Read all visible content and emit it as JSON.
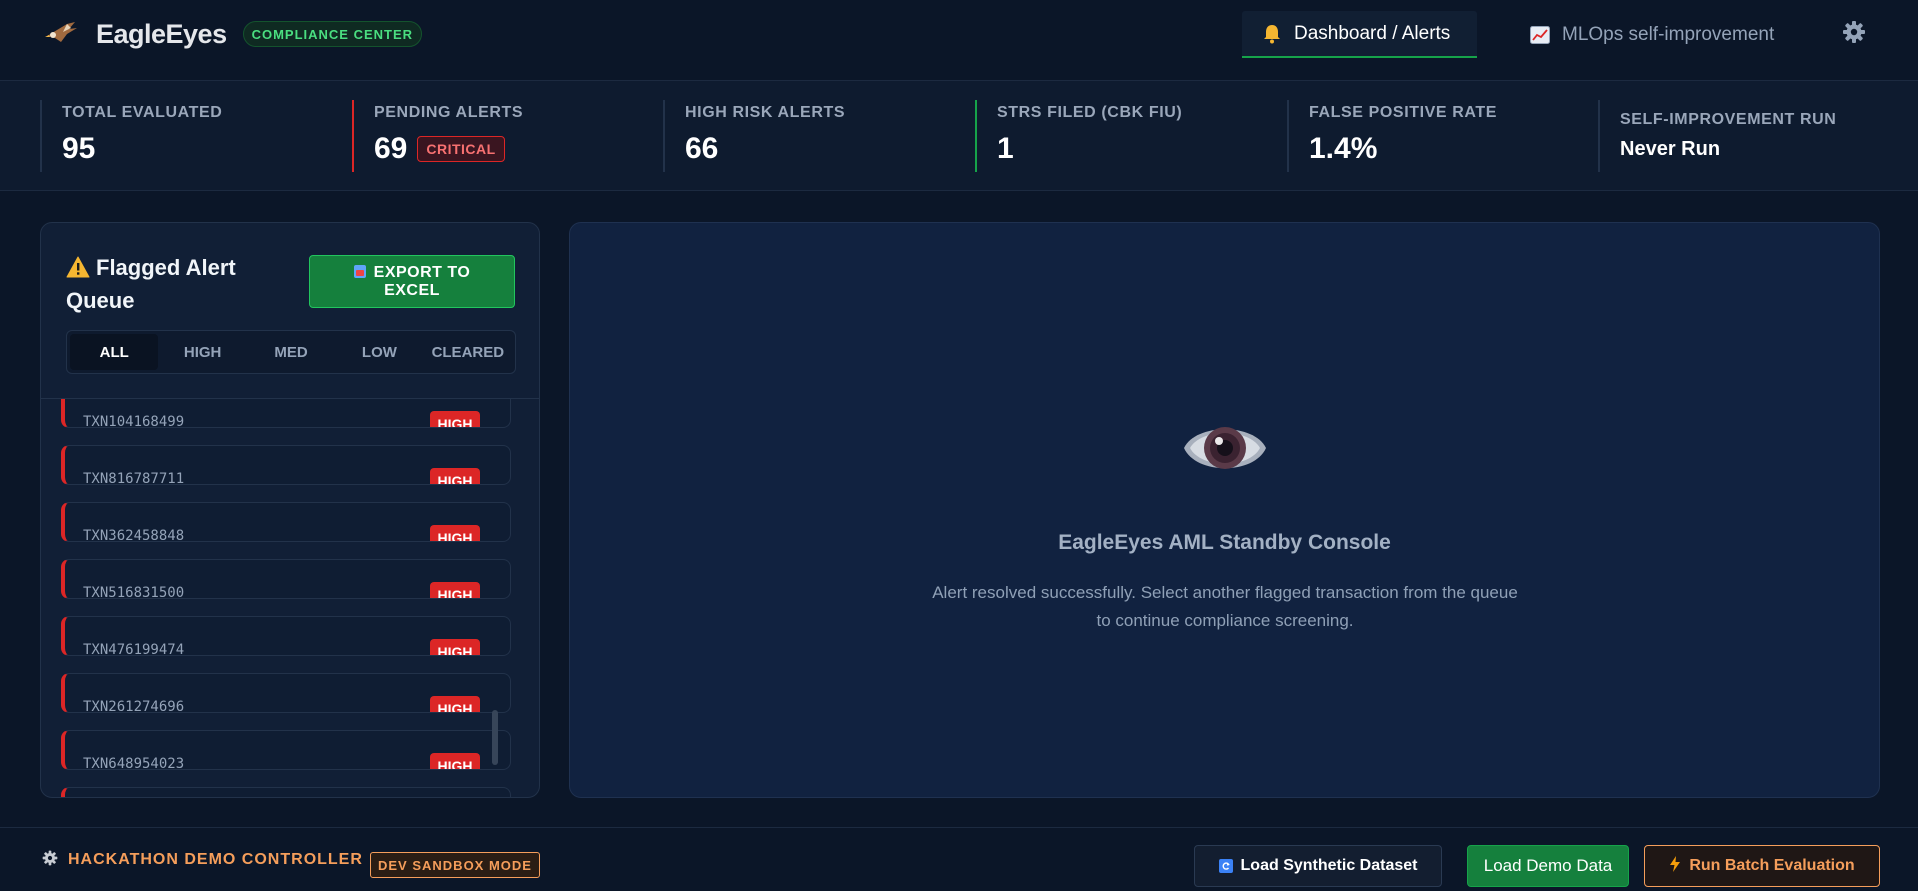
{
  "header": {
    "brand_name": "EagleEyes",
    "brand_badge": "COMPLIANCE CENTER",
    "nav_tabs": [
      {
        "label": "Dashboard / Alerts",
        "icon": "bell-icon",
        "active": true
      },
      {
        "label": "MLOps self-improvement",
        "icon": "chart-icon",
        "active": false
      }
    ],
    "settings_icon": "gear-icon"
  },
  "stats": [
    {
      "label": "TOTAL EVALUATED",
      "value": "95"
    },
    {
      "label": "PENDING ALERTS",
      "value": "69",
      "badge": "CRITICAL"
    },
    {
      "label": "HIGH RISK ALERTS",
      "value": "66"
    },
    {
      "label": "STRS FILED (CBK FIU)",
      "value": "1"
    },
    {
      "label": "FALSE POSITIVE RATE",
      "value": "1.4%"
    },
    {
      "label": "SELF-IMPROVEMENT RUN",
      "value": "Never Run"
    }
  ],
  "queue": {
    "title": "Flagged Alert Queue",
    "export_label": "EXPORT TO EXCEL",
    "filters": [
      "ALL",
      "HIGH",
      "MED",
      "LOW",
      "CLEARED"
    ],
    "active_filter": "ALL",
    "alerts": [
      {
        "id": "TXN104168499",
        "risk": "HIGH"
      },
      {
        "id": "TXN816787711",
        "risk": "HIGH"
      },
      {
        "id": "TXN362458848",
        "risk": "HIGH"
      },
      {
        "id": "TXN516831500",
        "risk": "HIGH"
      },
      {
        "id": "TXN476199474",
        "risk": "HIGH"
      },
      {
        "id": "TXN261274696",
        "risk": "HIGH"
      },
      {
        "id": "TXN648954023",
        "risk": "HIGH"
      }
    ]
  },
  "standby": {
    "title": "EagleEyes AML Standby Console",
    "message": "Alert resolved successfully. Select another flagged transaction from the queue to continue compliance screening."
  },
  "footer": {
    "controller_label": "HACKATHON DEMO CONTROLLER",
    "sandbox_badge": "DEV SANDBOX MODE",
    "load_synthetic_label": "Load Synthetic Dataset",
    "load_demo_label": "Load Demo Data",
    "run_batch_label": "Run Batch Evaluation"
  },
  "colors": {
    "background": "#0b1628",
    "panel": "#111f36",
    "accent_green": "#16a34a",
    "risk_high": "#dc2626",
    "accent_orange": "#f59e5b"
  }
}
